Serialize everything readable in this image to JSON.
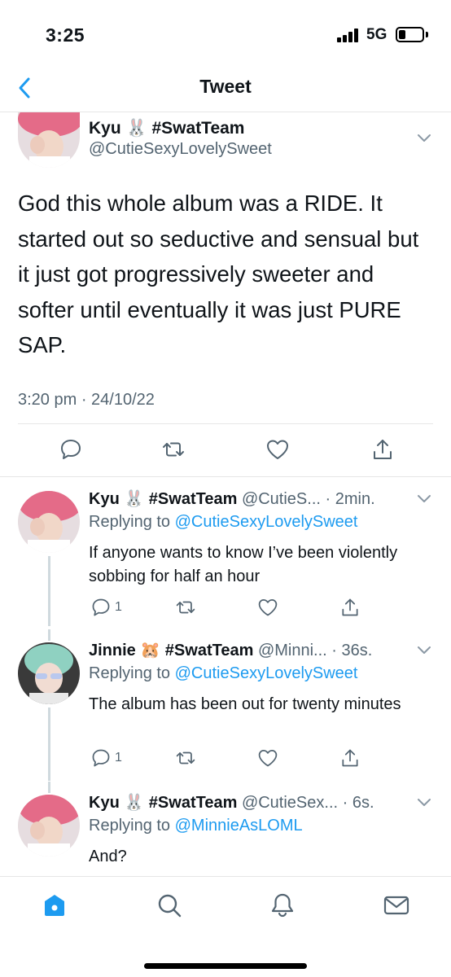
{
  "status_bar": {
    "time": "3:25",
    "network": "5G",
    "battery_level": 0.3
  },
  "header": {
    "title": "Tweet"
  },
  "main_tweet": {
    "author_name": "Kyu 🐰 #SwatTeam",
    "author_handle": "@CutieSexyLovelySweet",
    "text": "God this whole album was a RIDE. It started out so seductive and sensual but it just got progressively sweeter and softer until eventually it was just PURE SAP.",
    "timestamp": "3:20 pm · 24/10/22"
  },
  "replies": [
    {
      "author_name": "Kyu 🐰 #SwatTeam",
      "handle_time": "@CutieS... · 2min.",
      "replying_prefix": "Replying to ",
      "replying_to": "@CutieSexyLovelySweet",
      "text": "If anyone wants to know I’ve been violently sobbing for half an hour",
      "reply_count": "1"
    },
    {
      "author_name": "Jinnie 🐹 #SwatTeam",
      "handle_time": "@Minni... · 36s.",
      "replying_prefix": "Replying to ",
      "replying_to": "@CutieSexyLovelySweet",
      "text": "The album has been out for twenty minutes",
      "reply_count": "1"
    },
    {
      "author_name": "Kyu 🐰 #SwatTeam",
      "handle_time": "@CutieSex... · 6s.",
      "replying_prefix": "Replying to ",
      "replying_to": "@MinnieAsLOML",
      "text": "And?",
      "reply_count": ""
    }
  ],
  "icons": {
    "back": "chevron-left-icon",
    "reply": "speech-bubble-icon",
    "retweet": "retweet-icon",
    "like": "heart-icon",
    "share": "share-icon",
    "home": "home-icon",
    "search": "search-icon",
    "notifications": "bell-icon",
    "messages": "envelope-icon"
  },
  "colors": {
    "accent": "#1d9bf0",
    "text": "#0f1419",
    "secondary": "#536471",
    "border": "#e6e6e6"
  }
}
